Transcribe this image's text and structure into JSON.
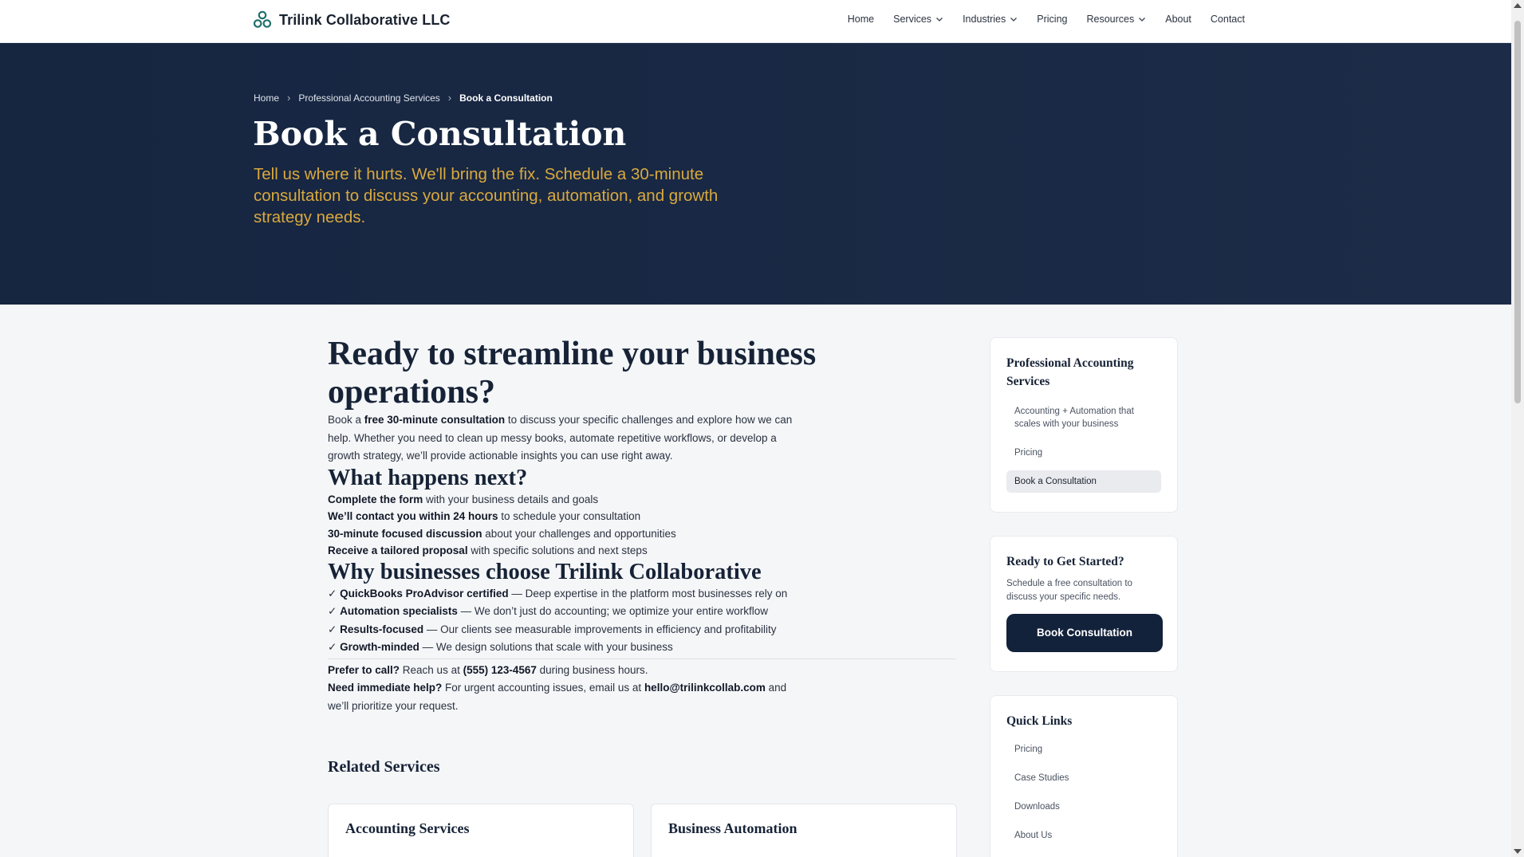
{
  "header": {
    "brand": "Trilink Collaborative LLC",
    "nav": [
      {
        "label": "Home",
        "dropdown": false
      },
      {
        "label": "Services",
        "dropdown": true
      },
      {
        "label": "Industries",
        "dropdown": true
      },
      {
        "label": "Pricing",
        "dropdown": false
      },
      {
        "label": "Resources",
        "dropdown": true
      },
      {
        "label": "About",
        "dropdown": false
      },
      {
        "label": "Contact",
        "dropdown": false
      }
    ]
  },
  "hero": {
    "breadcrumb": [
      "Home",
      "Professional Accounting Services",
      "Book a Consultation"
    ],
    "breadcrumb_sep": "›",
    "title": "Book a Consultation",
    "subtitle": "Tell us where it hurts. We'll bring the fix. Schedule a 30-minute consultation to discuss your accounting, automation, and growth strategy needs."
  },
  "main": {
    "heading": "Ready to streamline your business operations?",
    "intro_pre": "Book a ",
    "intro_bold": "free 30-minute consultation",
    "intro_post": " to discuss your specific challenges and explore how we can help. Whether you need to clean up messy books, automate repetitive workflows, or develop a growth strategy, we’ll provide actionable insights you can use right away.",
    "next_heading": "What happens next?",
    "steps": [
      {
        "bold": "Complete the form",
        "text": " with your business details and goals"
      },
      {
        "bold": "We’ll contact you within 24 hours",
        "text": " to schedule your consultation"
      },
      {
        "bold": "30-minute focused discussion",
        "text": " about your challenges and opportunities"
      },
      {
        "bold": "Receive a tailored proposal",
        "text": " with specific solutions and next steps"
      }
    ],
    "why_heading": "Why businesses choose Trilink Collaborative",
    "check": "✓",
    "why": [
      {
        "bold": "QuickBooks ProAdvisor certified",
        "text": " — Deep expertise in the platform most businesses rely on"
      },
      {
        "bold": "Automation specialists",
        "text": " — We don’t just do accounting; we optimize your entire workflow"
      },
      {
        "bold": "Results-focused",
        "text": " — Our clients see measurable improvements in efficiency and profitability"
      },
      {
        "bold": "Growth-minded",
        "text": " — We design solutions that scale with your business"
      }
    ],
    "call_bold": "Prefer to call?",
    "call_pre": " Reach us at ",
    "phone": "(555) 123-4567",
    "call_post": " during business hours.",
    "help_bold": "Need immediate help?",
    "help_pre": " For urgent accounting issues, email us at ",
    "email": "hello@trilinkcollab.com",
    "help_post": " and we’ll prioritize your request.",
    "related_title": "Related Services",
    "related": [
      "Accounting Services",
      "Business Automation"
    ]
  },
  "sidebar": {
    "section": {
      "title": "Professional Accounting Services",
      "links": [
        "Accounting + Automation that scales with your business",
        "Pricing",
        "Book a Consultation"
      ],
      "active_index": 2
    },
    "cta": {
      "title": "Ready to Get Started?",
      "text": "Schedule a free consultation to discuss your specific needs.",
      "button": "Book Consultation"
    },
    "quick": {
      "title": "Quick Links",
      "links": [
        "Pricing",
        "Case Studies",
        "Downloads",
        "About Us"
      ]
    }
  },
  "colors": {
    "hero_bg": "#1a2a45",
    "accent_gold": "#d9a93e",
    "button_bg": "#13223b"
  }
}
